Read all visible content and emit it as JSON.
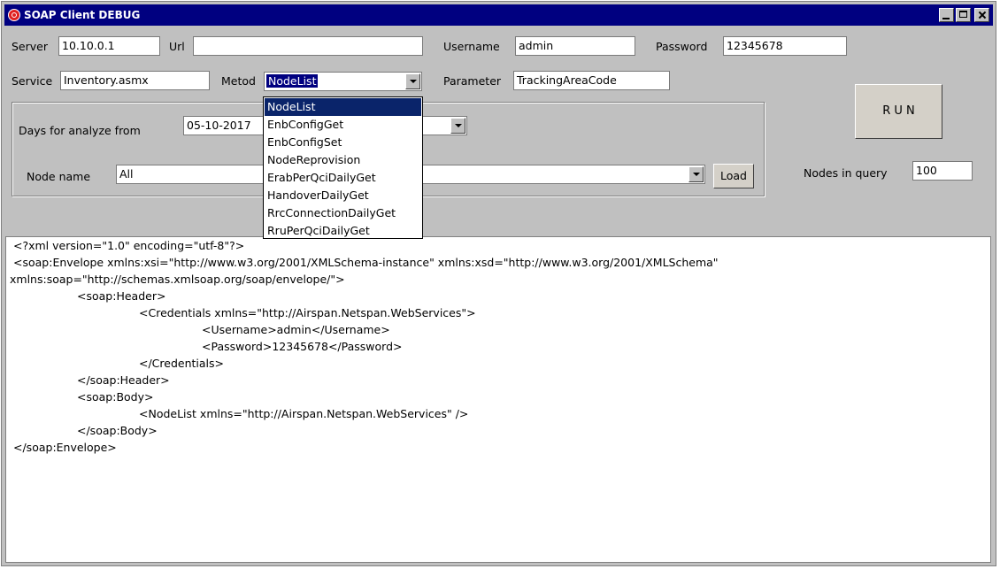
{
  "window": {
    "title": "SOAP Client  DEBUG"
  },
  "form": {
    "server_label": "Server",
    "server_value": "10.10.0.1",
    "url_label": "Url",
    "url_value": "",
    "username_label": "Username",
    "username_value": "admin",
    "password_label": "Password",
    "password_value": "12345678",
    "service_label": "Service",
    "service_value": "Inventory.asmx",
    "metod_label": "Metod",
    "metod_value": "NodeList",
    "parameter_label": "Parameter",
    "parameter_value": "TrackingAreaCode",
    "run_label": "R U N",
    "days_label": "Days for analyze  from",
    "date_value": "05-10-2017",
    "node_name_label": "Node name",
    "node_name_value": "All",
    "load_label": "Load",
    "nodes_in_query_label": "Nodes in query",
    "nodes_in_query_value": "100"
  },
  "metod_options": [
    "NodeList",
    "EnbConfigGet",
    "EnbConfigSet",
    "NodeReprovision",
    "ErabPerQciDailyGet",
    "HandoverDailyGet",
    "RrcConnectionDailyGet",
    "RruPerQciDailyGet"
  ],
  "xml_lines": [
    "<?xml version=\"1.0\" encoding=\"utf-8\"?>",
    "<soap:Envelope xmlns:xsi=\"http://www.w3.org/2001/XMLSchema-instance\" xmlns:xsd=\"http://www.w3.org/2001/XMLSchema\"",
    "xmlns:soap=\"http://schemas.xmlsoap.org/soap/envelope/\">",
    "<soap:Header>",
    "<Credentials xmlns=\"http://Airspan.Netspan.WebServices\">",
    "<Username>admin</Username>",
    "<Password>12345678</Password>",
    "</Credentials>",
    "</soap:Header>",
    "<soap:Body>",
    "<NodeList xmlns=\"http://Airspan.Netspan.WebServices\" />",
    "</soap:Body>",
    "</soap:Envelope>"
  ]
}
